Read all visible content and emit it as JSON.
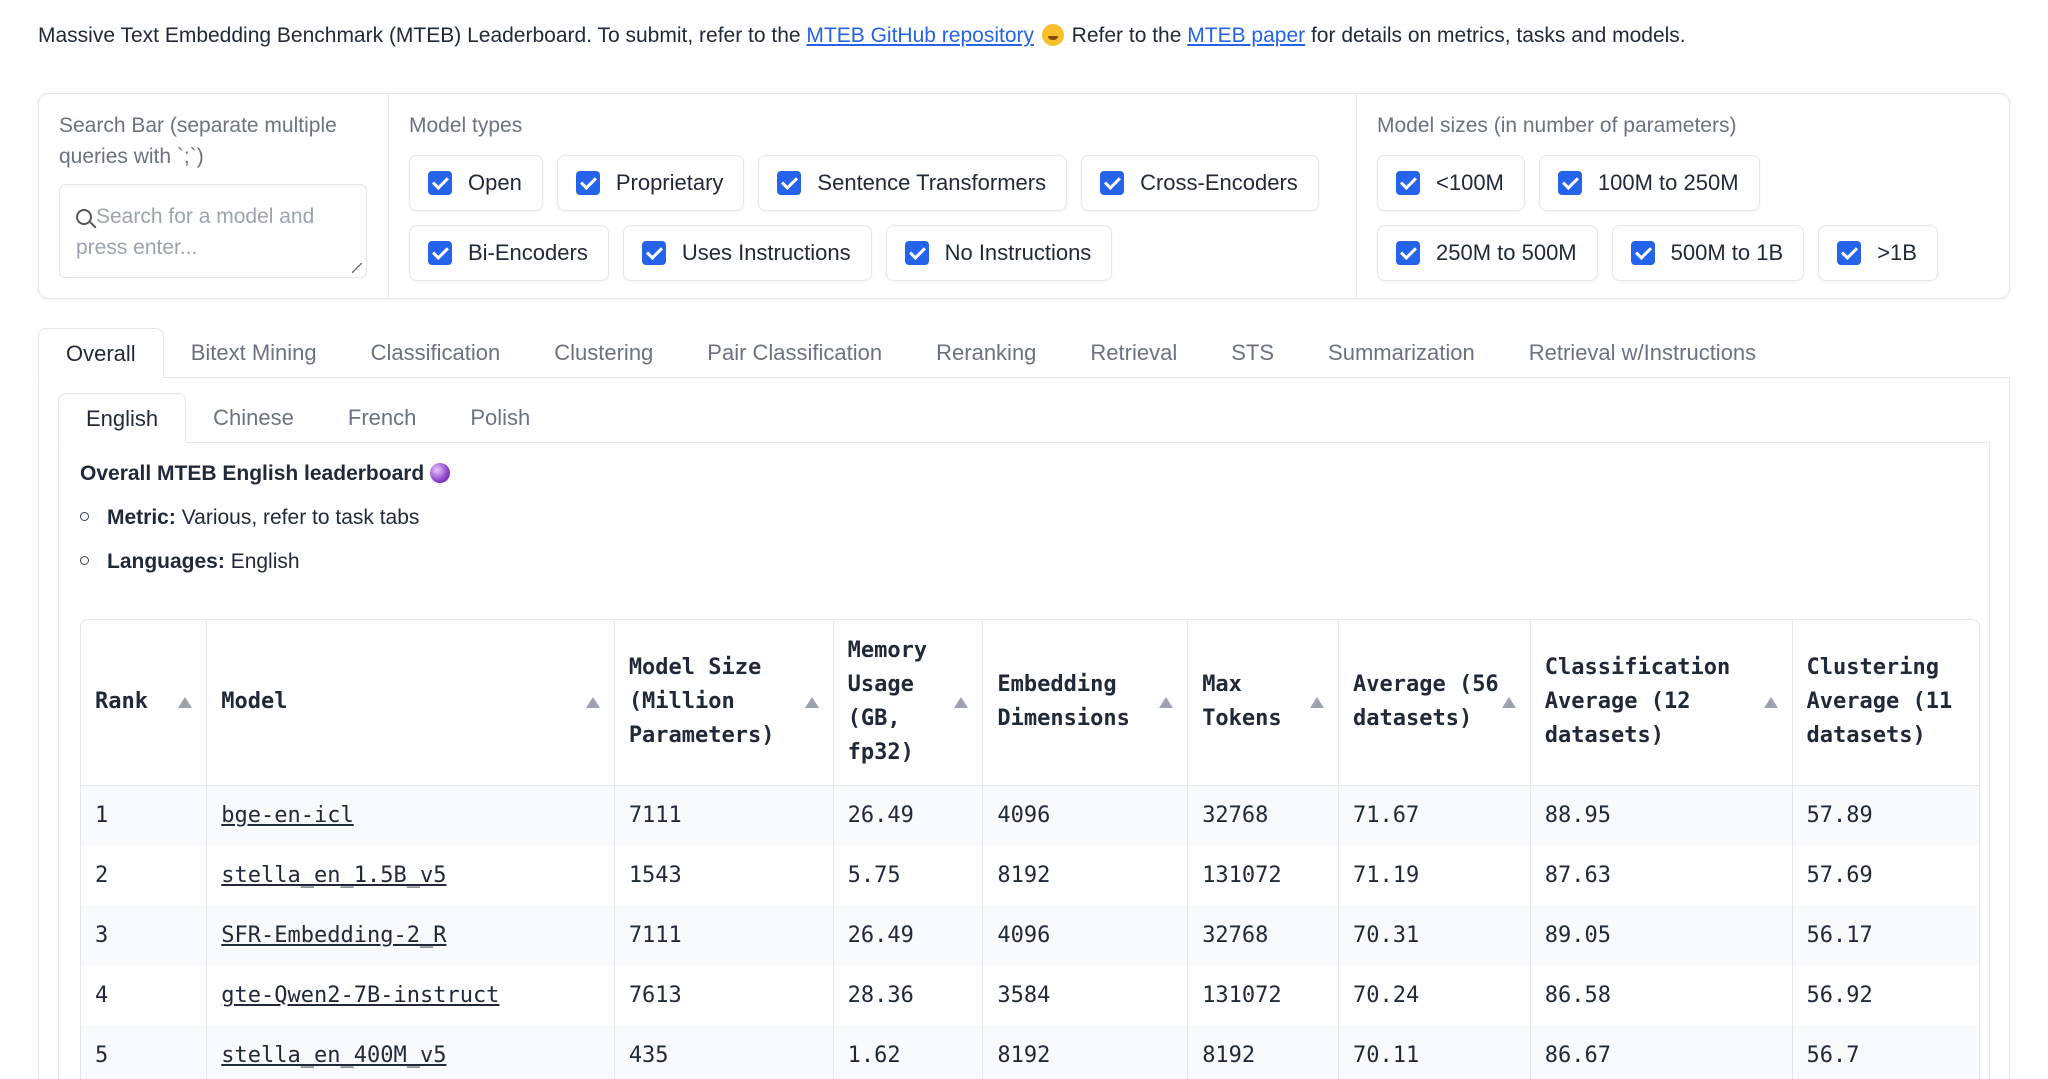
{
  "intro": {
    "text1": "Massive Text Embedding Benchmark (MTEB) Leaderboard. To submit, refer to the ",
    "link1": "MTEB GitHub repository",
    "text2": " Refer to the ",
    "link2": "MTEB paper",
    "text3": " for details on metrics, tasks and models."
  },
  "search": {
    "label": "Search Bar (separate multiple queries with `;`)",
    "placeholder": "Search for a model and press enter..."
  },
  "model_types": {
    "label": "Model types",
    "options": [
      "Open",
      "Proprietary",
      "Sentence Transformers",
      "Cross-Encoders",
      "Bi-Encoders",
      "Uses Instructions",
      "No Instructions"
    ]
  },
  "model_sizes": {
    "label": "Model sizes (in number of parameters)",
    "options": [
      "<100M",
      "100M to 250M",
      "250M to 500M",
      "500M to 1B",
      ">1B"
    ]
  },
  "tabs": [
    "Overall",
    "Bitext Mining",
    "Classification",
    "Clustering",
    "Pair Classification",
    "Reranking",
    "Retrieval",
    "STS",
    "Summarization",
    "Retrieval w/Instructions"
  ],
  "subtabs": [
    "English",
    "Chinese",
    "French",
    "Polish"
  ],
  "leaderboard": {
    "title": "Overall MTEB English leaderboard",
    "metric_label": "Metric:",
    "metric_value": " Various, refer to task tabs",
    "languages_label": "Languages:",
    "languages_value": " English"
  },
  "table": {
    "headers": [
      "Rank",
      "Model",
      "Model Size (Million Parameters)",
      "Memory Usage (GB, fp32)",
      "Embedding Dimensions",
      "Max Tokens",
      "Average (56 datasets)",
      "Classification Average (12 datasets)",
      "Clustering Average (11 datasets)"
    ],
    "rows": [
      [
        "1",
        "bge-en-icl",
        "7111",
        "26.49",
        "4096",
        "32768",
        "71.67",
        "88.95",
        "57.89"
      ],
      [
        "2",
        "stella_en_1.5B_v5",
        "1543",
        "5.75",
        "8192",
        "131072",
        "71.19",
        "87.63",
        "57.69"
      ],
      [
        "3",
        "SFR-Embedding-2_R",
        "7111",
        "26.49",
        "4096",
        "32768",
        "70.31",
        "89.05",
        "56.17"
      ],
      [
        "4",
        "gte-Qwen2-7B-instruct",
        "7613",
        "28.36",
        "3584",
        "131072",
        "70.24",
        "86.58",
        "56.92"
      ],
      [
        "5",
        "stella_en_400M_v5",
        "435",
        "1.62",
        "8192",
        "8192",
        "70.11",
        "86.67",
        "56.7"
      ]
    ]
  },
  "colors": {
    "accent": "#2563eb",
    "border": "#e5e7eb",
    "muted_text": "#6b7280"
  }
}
